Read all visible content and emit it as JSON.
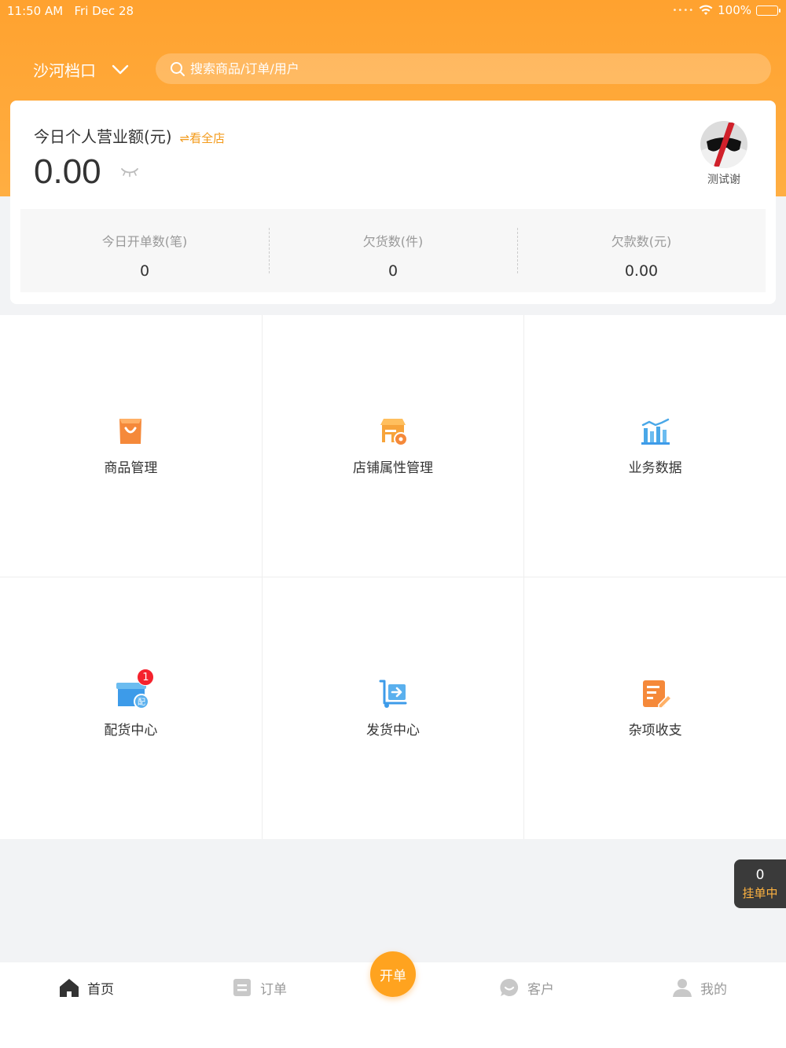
{
  "status_bar": {
    "time": "11:50 AM",
    "date": "Fri Dec 28",
    "battery": "100%"
  },
  "header": {
    "store_name": "沙河档口",
    "search_placeholder": "搜索商品/订单/用户"
  },
  "summary": {
    "title": "今日个人营业额(元)",
    "switch_label": "⇌看全店",
    "amount": "0.00",
    "user_name": "测试谢",
    "stats": [
      {
        "label": "今日开单数(笔)",
        "value": "0"
      },
      {
        "label": "欠货数(件)",
        "value": "0"
      },
      {
        "label": "欠款数(元)",
        "value": "0.00"
      }
    ]
  },
  "grid": {
    "items": [
      {
        "label": "商品管理",
        "icon": "shopping-bag-icon",
        "color": "#f5893a"
      },
      {
        "label": "店铺属性管理",
        "icon": "store-settings-icon",
        "color": "#f7a43b"
      },
      {
        "label": "业务数据",
        "icon": "bar-chart-icon",
        "color": "#4aa8e8"
      },
      {
        "label": "配货中心",
        "icon": "distribution-box-icon",
        "color": "#3d9be9",
        "badge": "1"
      },
      {
        "label": "发货中心",
        "icon": "shipping-cart-icon",
        "color": "#3d9be9"
      },
      {
        "label": "杂项收支",
        "icon": "edit-note-icon",
        "color": "#f5893a"
      }
    ]
  },
  "pending": {
    "count": "0",
    "label": "挂单中"
  },
  "tabbar": {
    "items": [
      {
        "label": "首页",
        "icon": "home-icon"
      },
      {
        "label": "订单",
        "icon": "order-icon"
      },
      {
        "label": "客户",
        "icon": "customer-icon"
      },
      {
        "label": "我的",
        "icon": "profile-icon"
      }
    ],
    "open_label": "开单"
  },
  "colors": {
    "brand": "#ffa22f",
    "accent_text": "#f39a1a",
    "badge": "#f5222d"
  }
}
